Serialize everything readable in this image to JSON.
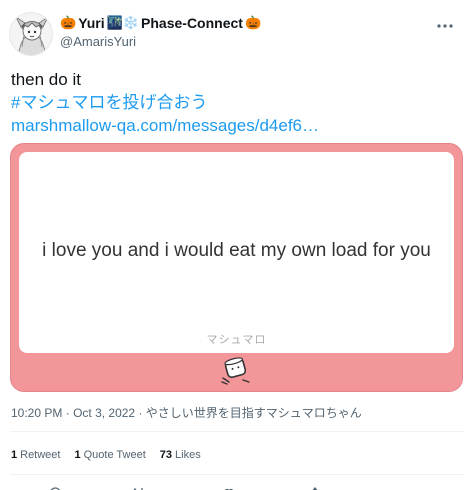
{
  "author": {
    "display_name_prefix_emoji": "🎃",
    "display_name": "Yuri",
    "display_name_emojis": "🌃❄️",
    "affiliation": "Phase-Connect",
    "affiliation_suffix_emoji": "🎃",
    "handle": "@AmarisYuri"
  },
  "tweet": {
    "text": "then do it",
    "hashtag": "#マシュマロを投げ合おう",
    "link": "marshmallow-qa.com/messages/d4ef6…"
  },
  "card": {
    "message": "i love you and i would eat my own load for you",
    "brand": "マシュマロ",
    "background_color": "#f3969a"
  },
  "meta": {
    "time": "10:20 PM",
    "sep": "·",
    "date": "Oct 3, 2022",
    "source": "やさしい世界を目指すマシュマロちゃん"
  },
  "stats": {
    "retweets_count": "1",
    "retweets_label": "Retweet",
    "quote_count": "1",
    "quote_label": "Quote Tweet",
    "likes_count": "73",
    "likes_label": "Likes"
  },
  "icons": {
    "more": "more-dots-icon",
    "reply": "reply-icon",
    "retweet": "retweet-icon",
    "like": "heart-icon",
    "share": "share-icon"
  },
  "colors": {
    "link": "#1d9bf0",
    "text": "#0f1419",
    "secondary": "#536471"
  }
}
